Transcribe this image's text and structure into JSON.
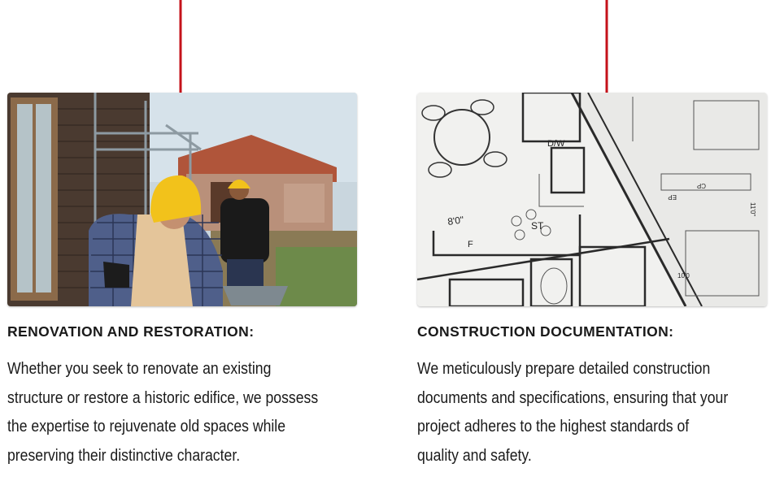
{
  "colors": {
    "arrow": "#c4121a",
    "text": "#1a1a1a"
  },
  "cards": [
    {
      "image_alt": "Two construction workers in yellow hard hats renovating a wooden house",
      "title": "RENOVATION AND RESTORATION:",
      "body_lines": [
        "Whether you seek to renovate an existing",
        "structure or restore a historic edifice, we possess",
        "the expertise to rejuvenate old spaces while",
        "preserving their distinctive character."
      ]
    },
    {
      "image_alt": "Architectural floor plan blueprints",
      "title": "CONSTRUCTION DOCUMENTATION:",
      "body_lines": [
        "We meticulously prepare detailed construction",
        "documents and specifications, ensuring that your",
        "project adheres to the highest standards of",
        "quality and safety."
      ],
      "plan_labels": {
        "dw": "D/W",
        "dim": "8'0\"",
        "st": "ST",
        "f": "F",
        "cp": "CP",
        "ep": "EP",
        "h10": "10'0",
        "h11": "11'0\""
      }
    }
  ]
}
